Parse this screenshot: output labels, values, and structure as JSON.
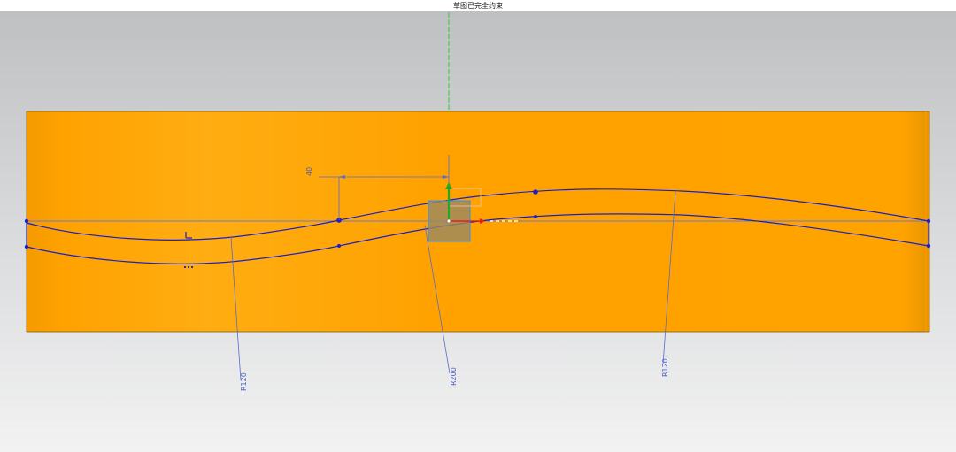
{
  "status_bar": {
    "message": "草图已完全约束"
  },
  "viewport": {
    "background_top": "#bfc0c2",
    "background_bottom": "#f0f0f0",
    "part_color": "#ffa200",
    "sketch_color": "#1a1fc8",
    "dimension_color": "#5a6ad0",
    "y_axis_color": "#33cc33",
    "x_axis_color": "#e02020"
  },
  "dimensions": {
    "radius_left": "R120",
    "radius_middle": "R200",
    "radius_right": "R120",
    "horizontal_offset": "40"
  },
  "icons": [
    "csys-origin-icon",
    "constraint-horizontal-icon",
    "constraint-dots-icon"
  ]
}
